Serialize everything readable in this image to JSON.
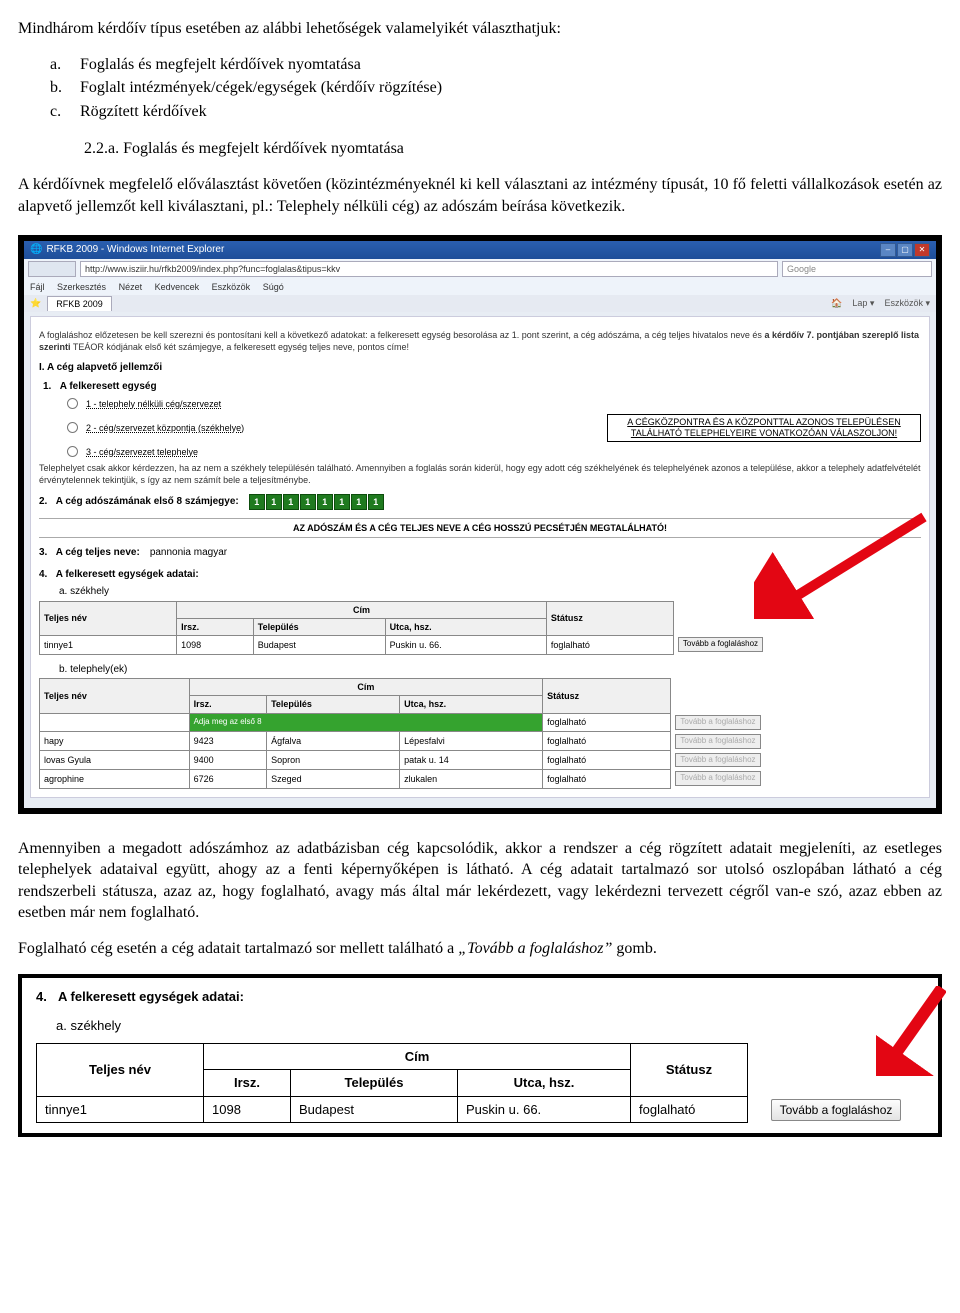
{
  "doc": {
    "intro": "Mindhárom kérdőív típus esetében az alábbi lehetőségek valamelyikét választhatjuk:",
    "list": [
      {
        "bullet": "a.",
        "text": "Foglalás és megfejelt kérdőívek nyomtatása"
      },
      {
        "bullet": "b.",
        "text": "Foglalt intézmények/cégek/egységek (kérdőív rögzítése)"
      },
      {
        "bullet": "c.",
        "text": "Rögzített kérdőívek"
      }
    ],
    "subnum": "2.2.a.  Foglalás és megfejelt kérdőívek nyomtatása",
    "para1": "A kérdőívnek megfelelő előválasztást követően (közintézményeknél ki kell választani az intézmény típusát, 10 fő feletti vállalkozások esetén az alapvető jellemzőt kell kiválasztani, pl.: Telephely nélküli cég) az adószám beírása következik.",
    "para2_a": "Amennyiben a megadott adószámhoz az adatbázisban cég kapcsolódik, akkor a rendszer a cég rögzített adatait megjeleníti, az esetleges telephelyek adataival együtt, ahogy az a fenti képernyőképen is látható. A cég adatait tartalmazó sor utolsó oszlopában látható a cég rendszerbeli státusza, azaz az, hogy foglalható, avagy más által már lekérdezett, vagy lekérdezni tervezett cégről van-e szó, azaz ebben az esetben már nem foglalható.",
    "para3_a": "Foglalható cég esetén a cég adatait tartalmazó sor mellett található a ",
    "para3_i": "„Tovább a foglaláshoz”",
    "para3_b": " gomb."
  },
  "ie": {
    "title": "RFKB 2009 - Windows Internet Explorer",
    "url": "http://www.isziir.hu/rfkb2009/index.php?func=foglalas&tipus=kkv",
    "search": "Google",
    "menu": [
      "Fájl",
      "Szerkesztés",
      "Nézet",
      "Kedvencek",
      "Eszközök",
      "Súgó"
    ],
    "tab": "RFKB 2009",
    "tools": [
      "Lap ▾",
      "Eszközök ▾"
    ]
  },
  "form": {
    "intro": "A foglaláshoz előzetesen be kell szerezni és pontosítani kell a következő adatokat: a felkeresett egység besorolása az 1. pont szerint, a cég adószáma, a cég teljes hivatalos neve és a kérdőív 7. pontjában szereplő lista szerinti TEÁOR kódjának első két számjegye, a felkeresett egység teljes neve, pontos címe!",
    "sec1": "I. A cég alapvető jellemzői",
    "q1": "A felkeresett egység",
    "opt1": "1 - telephely nélküli cég/szervezet",
    "opt2": "2 - cég/szervezet központja (székhelye)",
    "opt3": "3 - cég/szervezet telephelye",
    "notebox": "A CÉGKÖZPONTRA ÉS A KÖZPONTTAL AZONOS TELEPÜLÉSEN TALÁLHATÓ TELEPHELYEIRE VONATKOZÓAN VÁLASZOLJON!",
    "tnote": "Telephelyet csak akkor kérdezzen, ha az nem a székhely településén található. Amennyiben a foglalás során kiderül, hogy egy adott cég székhelyének és telephelyének azonos a települése, akkor a telephely adatfelvételét érvénytelennek tekintjük, s így az nem számít bele a teljesítménybe.",
    "q2": "A cég adószámának első 8 számjegye:",
    "digits": [
      "1",
      "1",
      "1",
      "1",
      "1",
      "1",
      "1",
      "1"
    ],
    "centerbar": "AZ ADÓSZÁM ÉS A CÉG TELJES NEVE A CÉG HOSSZÚ PECSÉTJÉN MEGTALÁLHATÓ!",
    "q3": "A cég teljes neve:",
    "q3val": "pannonia magyar",
    "q4": "A felkeresett egységek adatai:",
    "sub_a": "a. székhely",
    "sub_b": "b. telephely(ek)",
    "headers": {
      "teljes": "Teljes név",
      "cim": "Cím",
      "irsz": "Irsz.",
      "telepules": "Település",
      "utca": "Utca, hsz.",
      "status": "Státusz"
    },
    "row_a": {
      "nev": "tinnye1",
      "irsz": "1098",
      "tel": "Budapest",
      "utca": "Puskin u. 66.",
      "status": "foglalható",
      "btn": "Tovább a foglaláshoz"
    },
    "rows_b": [
      {
        "nev": "hapy",
        "irsz": "9423",
        "tel": "Ágfalva",
        "utca": "Lépesfalvi",
        "status": "foglalható",
        "btn": "Tovább a foglaláshoz"
      },
      {
        "nev": "lovas Gyula",
        "irsz": "9400",
        "tel": "Sopron",
        "utca": "patak u. 14",
        "status": "foglalható",
        "btn": "Tovább a foglaláshoz"
      },
      {
        "nev": "agrophine",
        "irsz": "6726",
        "tel": "Szeged",
        "utca": "zlukalen",
        "status": "foglalható",
        "btn": "Tovább a foglaláshoz"
      }
    ],
    "green_hint": "Adja meg az első 8"
  },
  "shot2": {
    "q4n": "4.",
    "q4": "A felkeresett egységek adatai:",
    "sub": "a. székhely",
    "headers": {
      "teljes": "Teljes név",
      "cim": "Cím",
      "irsz": "Irsz.",
      "tel": "Település",
      "utca": "Utca, hsz.",
      "status": "Státusz"
    },
    "row": {
      "nev": "tinnye1",
      "irsz": "1098",
      "tel": "Budapest",
      "utca": "Puskin u. 66.",
      "status": "foglalható",
      "btn": "Tovább a foglaláshoz"
    }
  }
}
